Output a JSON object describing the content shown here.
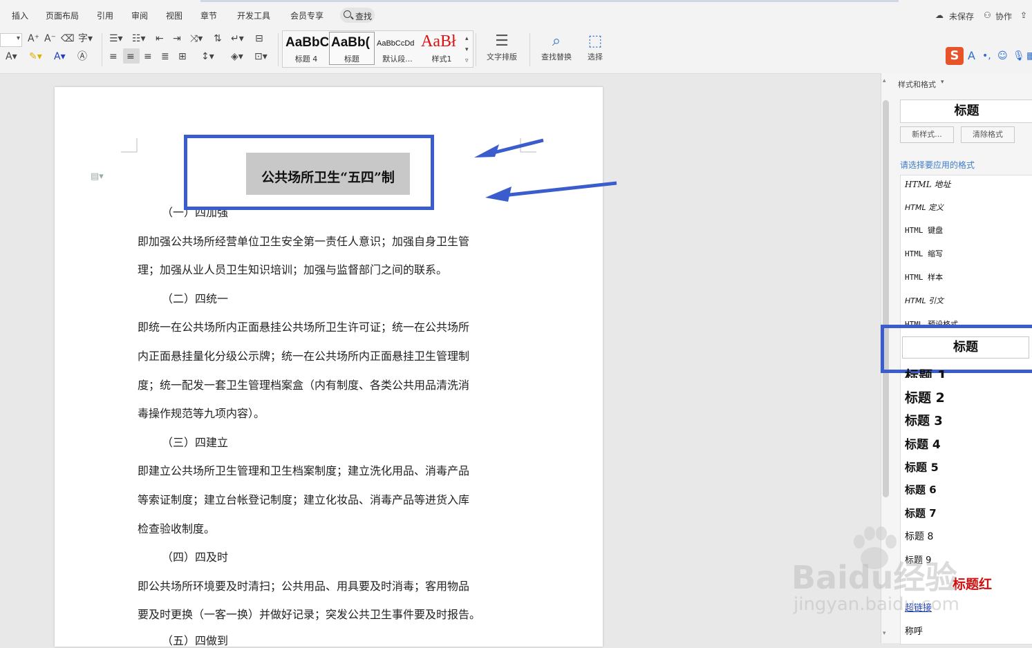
{
  "menu": {
    "items": [
      "插入",
      "页面布局",
      "引用",
      "审阅",
      "视图",
      "章节",
      "开发工具",
      "会员专享"
    ],
    "search_label": "查找",
    "unsaved": "未保存",
    "collaborate": "协作"
  },
  "ribbon": {
    "styles": [
      {
        "preview": "AaBbC",
        "label": "标题 4"
      },
      {
        "preview": "AaBb(",
        "label": "标题"
      },
      {
        "preview": "AaBbCcDd",
        "label": "默认段..."
      },
      {
        "preview": "AaBł",
        "label": "样式1"
      }
    ],
    "text_layout": "文字排版",
    "find_replace": "查找替换",
    "select": "选择"
  },
  "document": {
    "title": "公共场所卫生“五四”制",
    "paragraphs": [
      "（一）四加强",
      "即加强公共场所经营单位卫生安全第一责任人意识；加强自身卫生管",
      "理；加强从业人员卫生知识培训；加强与监督部门之间的联系。",
      "（二）四统一",
      "即统一在公共场所内正面悬挂公共场所卫生许可证；统一在公共场所",
      "内正面悬挂量化分级公示牌；统一在公共场所内正面悬挂卫生管理制",
      "度；统一配发一套卫生管理档案盒（内有制度、各类公共用品清洗消",
      "毒操作规范等九项内容）。",
      "（三）四建立",
      "即建立公共场所卫生管理和卫生档案制度；建立洗化用品、消毒产品",
      "等索证制度；建立台帐登记制度；建立化妆品、消毒产品等进货入库",
      "检查验收制度。",
      "（四）四及时",
      "即公共场所环境要及时清扫；公共用品、用具要及时消毒；客用物品",
      "要及时更换（一客一换）并做好记录；突发公共卫生事件要及时报告。",
      "（五）四做到"
    ]
  },
  "pane": {
    "title": "样式和格式",
    "current_style": "标题",
    "new_style": "新样式...",
    "clear_format": "清除格式",
    "prompt": "请选择要应用的格式",
    "styles": [
      "HTML 地址",
      "HTML 定义",
      "HTML 键盘",
      "HTML 缩写",
      "HTML 样本",
      "HTML 引文",
      "HTML 预设格式",
      "标题",
      "标题 1",
      "标题 2",
      "标题 3",
      "标题 4",
      "标题 5",
      "标题 6",
      "标题 7",
      "标题 8",
      "标题 9",
      "标题红",
      "超链接",
      "称呼"
    ]
  },
  "watermark": {
    "brand": "Baidu经验",
    "url": "jingyan.baidu.com"
  },
  "colors": {
    "annotation": "#3b5ccc",
    "link": "#3d7cc9",
    "red_style": "#cc1111"
  }
}
